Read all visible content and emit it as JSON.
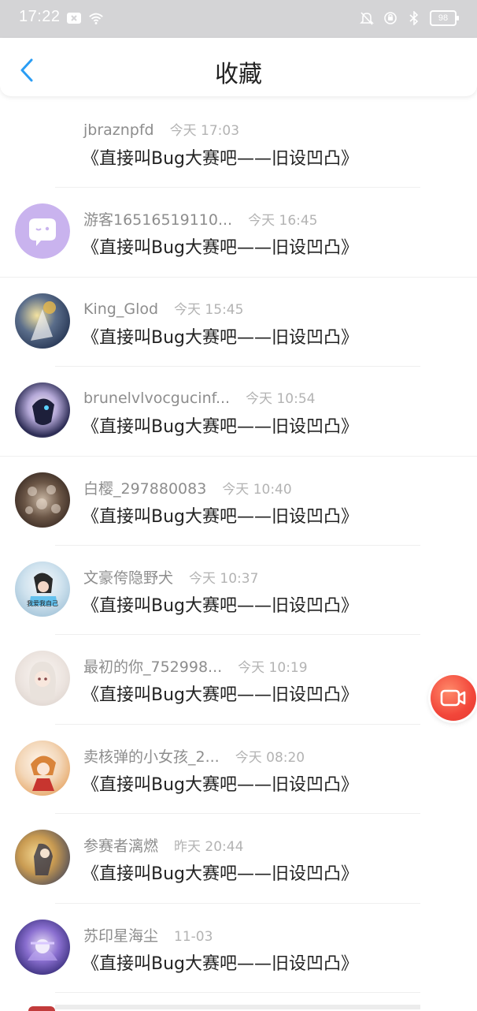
{
  "status_bar": {
    "time": "17:22",
    "battery": "98",
    "icons": [
      "notification-x-icon",
      "wifi-icon",
      "mute-bell-icon",
      "alarm-icon",
      "bluetooth-icon",
      "battery-icon"
    ]
  },
  "header": {
    "title": "收藏",
    "back_icon": "chevron-left-icon"
  },
  "items": [
    {
      "username": "jbraznpfd",
      "time": "今天 17:03",
      "title": "《直接叫Bug大赛吧——旧设凹凸》",
      "avatar": "none"
    },
    {
      "username": "游客16516519110...",
      "time": "今天 16:45",
      "title": "《直接叫Bug大赛吧——旧设凹凸》",
      "avatar": "default-chat"
    },
    {
      "username": "King_Glod",
      "time": "今天 15:45",
      "title": "《直接叫Bug大赛吧——旧设凹凸》",
      "avatar": "photo"
    },
    {
      "username": "brunelvlvocgucinf...",
      "time": "今天 10:54",
      "title": "《直接叫Bug大赛吧——旧设凹凸》",
      "avatar": "photo"
    },
    {
      "username": "白樱_297880083",
      "time": "今天 10:40",
      "title": "《直接叫Bug大赛吧——旧设凹凸》",
      "avatar": "photo"
    },
    {
      "username": "文豪侉隐野犬",
      "time": "今天 10:37",
      "title": "《直接叫Bug大赛吧——旧设凹凸》",
      "avatar": "photo",
      "avatar_caption": "我爱我自己"
    },
    {
      "username": "最初的你_752998...",
      "time": "今天 10:19",
      "title": "《直接叫Bug大赛吧——旧设凹凸》",
      "avatar": "photo"
    },
    {
      "username": "卖核弹的小女孩_2...",
      "time": "今天 08:20",
      "title": "《直接叫Bug大赛吧——旧设凹凸》",
      "avatar": "photo"
    },
    {
      "username": "参赛者漓燃",
      "time": "昨天 20:44",
      "title": "《直接叫Bug大赛吧——旧设凹凸》",
      "avatar": "photo"
    },
    {
      "username": "苏印星海尘",
      "time": "11-03",
      "title": "《直接叫Bug大赛吧——旧设凹凸》",
      "avatar": "photo"
    }
  ],
  "fab": {
    "icon": "video-record-icon"
  },
  "colors": {
    "accent": "#2a9df4",
    "fab": "#f2463a",
    "username": "#8d8d8d",
    "time": "#b3b3b3",
    "title": "#222222"
  }
}
